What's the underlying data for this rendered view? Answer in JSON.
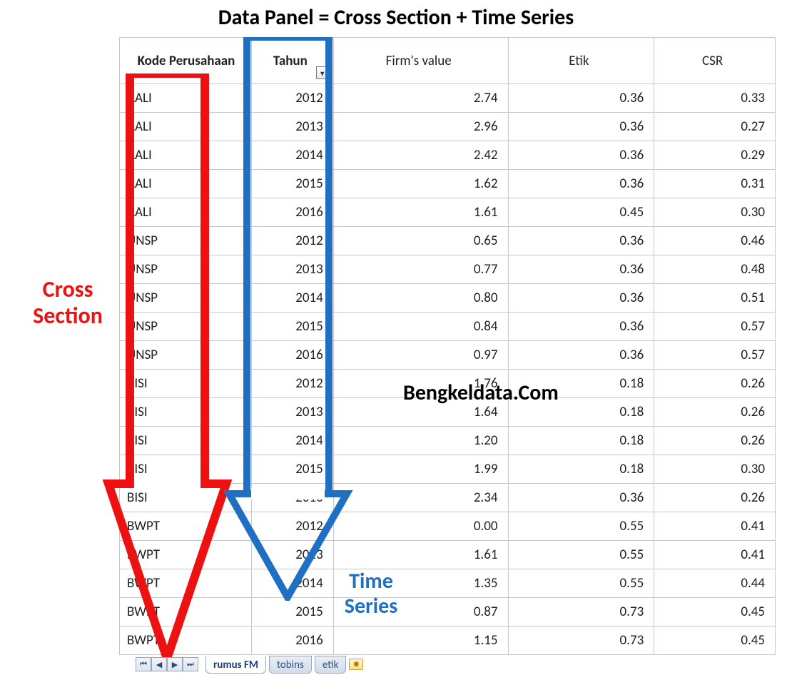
{
  "title": "Data Panel = Cross Section + Time Series",
  "headers": {
    "kode": "Kode Perusahaan",
    "tahun": "Tahun",
    "fv": "Firm's value",
    "etik": "Etik",
    "csr": "CSR"
  },
  "rows": [
    {
      "kode": "AALI",
      "tahun": "2012",
      "fv": "2.74",
      "etik": "0.36",
      "csr": "0.33"
    },
    {
      "kode": "AALI",
      "tahun": "2013",
      "fv": "2.96",
      "etik": "0.36",
      "csr": "0.27"
    },
    {
      "kode": "AALI",
      "tahun": "2014",
      "fv": "2.42",
      "etik": "0.36",
      "csr": "0.29"
    },
    {
      "kode": "AALI",
      "tahun": "2015",
      "fv": "1.62",
      "etik": "0.36",
      "csr": "0.31"
    },
    {
      "kode": "AALI",
      "tahun": "2016",
      "fv": "1.61",
      "etik": "0.45",
      "csr": "0.30"
    },
    {
      "kode": "UNSP",
      "tahun": "2012",
      "fv": "0.65",
      "etik": "0.36",
      "csr": "0.46"
    },
    {
      "kode": "UNSP",
      "tahun": "2013",
      "fv": "0.77",
      "etik": "0.36",
      "csr": "0.48"
    },
    {
      "kode": "UNSP",
      "tahun": "2014",
      "fv": "0.80",
      "etik": "0.36",
      "csr": "0.51"
    },
    {
      "kode": "UNSP",
      "tahun": "2015",
      "fv": "0.84",
      "etik": "0.36",
      "csr": "0.57"
    },
    {
      "kode": "UNSP",
      "tahun": "2016",
      "fv": "0.97",
      "etik": "0.36",
      "csr": "0.57"
    },
    {
      "kode": "BISI",
      "tahun": "2012",
      "fv": "1.76",
      "etik": "0.18",
      "csr": "0.26"
    },
    {
      "kode": "BISI",
      "tahun": "2013",
      "fv": "1.64",
      "etik": "0.18",
      "csr": "0.26"
    },
    {
      "kode": "BISI",
      "tahun": "2014",
      "fv": "1.20",
      "etik": "0.18",
      "csr": "0.26"
    },
    {
      "kode": "BISI",
      "tahun": "2015",
      "fv": "1.99",
      "etik": "0.18",
      "csr": "0.30"
    },
    {
      "kode": "BISI",
      "tahun": "2016",
      "fv": "2.34",
      "etik": "0.36",
      "csr": "0.26"
    },
    {
      "kode": "BWPT",
      "tahun": "2012",
      "fv": "0.00",
      "etik": "0.55",
      "csr": "0.41"
    },
    {
      "kode": "BWPT",
      "tahun": "2013",
      "fv": "1.61",
      "etik": "0.55",
      "csr": "0.41"
    },
    {
      "kode": "BWPT",
      "tahun": "2014",
      "fv": "1.35",
      "etik": "0.55",
      "csr": "0.44"
    },
    {
      "kode": "BWPT",
      "tahun": "2015",
      "fv": "0.87",
      "etik": "0.73",
      "csr": "0.45"
    },
    {
      "kode": "BWPT",
      "tahun": "2016",
      "fv": "1.15",
      "etik": "0.73",
      "csr": "0.45"
    }
  ],
  "labels": {
    "cross": "Cross Section",
    "time": "Time Series",
    "watermark": "Bengkeldata.Com"
  },
  "tabs": {
    "items": [
      "rumus FM",
      "tobins",
      "etik"
    ],
    "active": "rumus FM"
  },
  "colors": {
    "cross_arrow": "#e11",
    "time_arrow": "#1f6fc2"
  }
}
